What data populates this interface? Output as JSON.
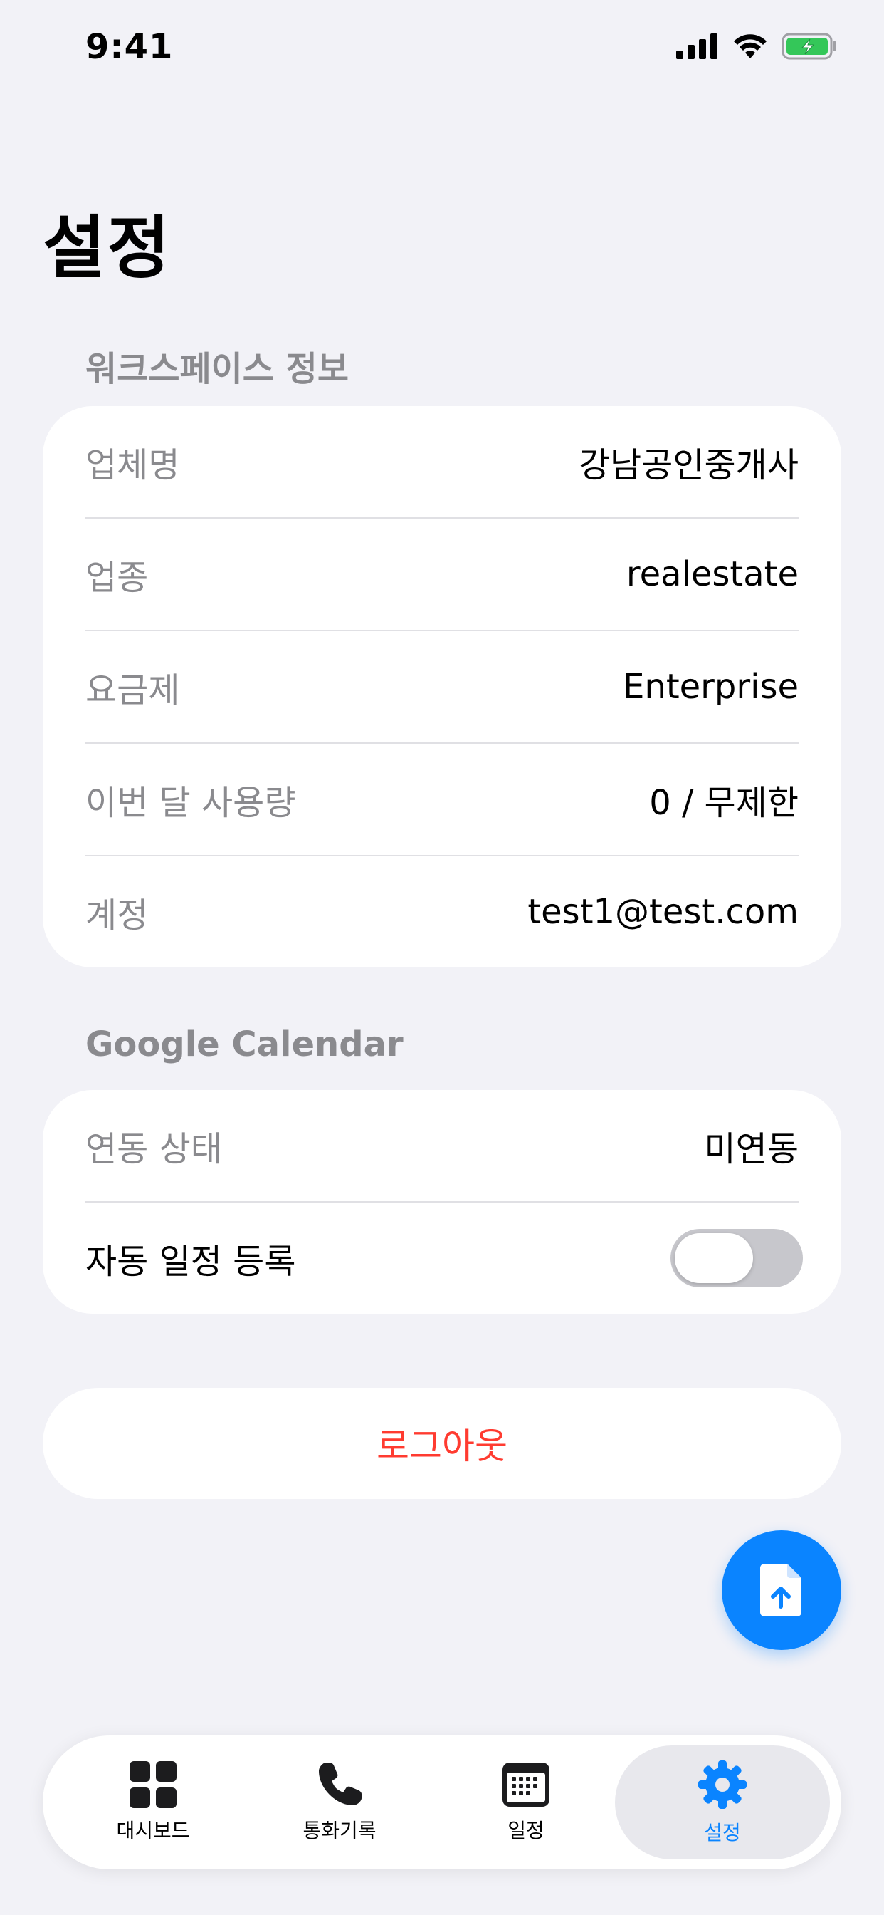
{
  "status_bar": {
    "time": "9:41"
  },
  "page": {
    "title": "설정"
  },
  "workspace": {
    "header": "워크스페이스 정보",
    "rows": [
      {
        "label": "업체명",
        "value": "강남공인중개사"
      },
      {
        "label": "업종",
        "value": "realestate"
      },
      {
        "label": "요금제",
        "value": "Enterprise"
      },
      {
        "label": "이번 달 사용량",
        "value": "0 / 무제한"
      },
      {
        "label": "계정",
        "value": "test1@test.com"
      }
    ]
  },
  "google_calendar": {
    "header": "Google Calendar",
    "status_label": "연동 상태",
    "status_value": "미연동",
    "auto_label": "자동 일정 등록",
    "auto_enabled": false
  },
  "logout": {
    "label": "로그아웃"
  },
  "fab": {
    "icon": "document-upload-icon"
  },
  "tabs": [
    {
      "label": "대시보드",
      "icon": "grid-icon",
      "active": false
    },
    {
      "label": "통화기록",
      "icon": "phone-icon",
      "active": false
    },
    {
      "label": "일정",
      "icon": "calendar-icon",
      "active": false
    },
    {
      "label": "설정",
      "icon": "gear-icon",
      "active": true
    }
  ],
  "colors": {
    "accent": "#0a84ff",
    "danger": "#ff3b30",
    "background": "#f2f2f7",
    "battery": "#34c759"
  }
}
